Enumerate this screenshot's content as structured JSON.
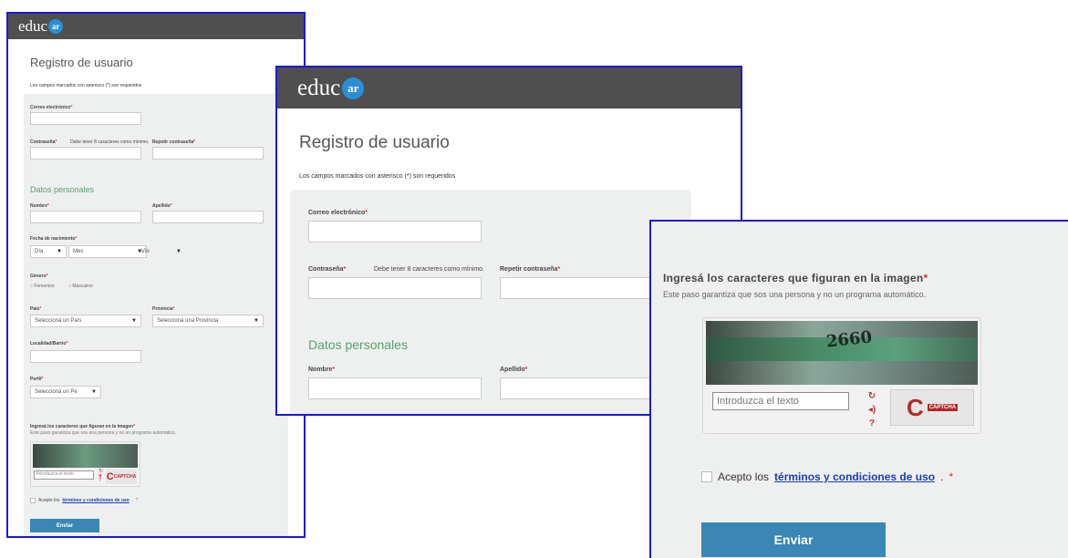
{
  "logo": {
    "text": "educ",
    "badge": "ar"
  },
  "page": {
    "title": "Registro de usuario",
    "required_note": "Los campos marcados con asterisco (*) son requeridos"
  },
  "fields": {
    "email": "Correo electrónico",
    "password": "Contraseña",
    "password_hint": "Debe tener 8 caracteres como mínimo.",
    "repeat_password": "Repetir contraseña",
    "section_personal": "Datos personales",
    "first_name": "Nombre",
    "last_name": "Apellido",
    "birth_date": "Fecha de nacimiento",
    "day": "Día",
    "month": "Mes",
    "year": "Año",
    "gender": "Género",
    "female": "Femenino",
    "male": "Masculino",
    "country": "País",
    "country_value": "Seleccioná un País",
    "province": "Provincia",
    "province_value": "Seleccioná una Provincia",
    "locality": "Localidad/Barrio",
    "profile": "Perfil",
    "profile_value": "Seleccioná un Pe"
  },
  "asterisk": "*",
  "captcha": {
    "title": "Ingresá los caracteres que figuran en la imagen",
    "subtitle": "Este paso garantiza que sos una persona y no un programa automático.",
    "image_text": "2660",
    "placeholder": "Introduzca el texto",
    "icons": [
      "refresh-icon",
      "audio-icon",
      "help-icon"
    ],
    "brand": "CAPTCHA"
  },
  "terms": {
    "prefix": "Acepto los",
    "link": "términos y condiciones de uso",
    "suffix": "."
  },
  "submit": "Enviar",
  "colors": {
    "header": "#4f4f4f",
    "accent": "#3a86b4",
    "section": "#55a36a",
    "required": "#d9342b",
    "frame": "#1a1ad6"
  }
}
